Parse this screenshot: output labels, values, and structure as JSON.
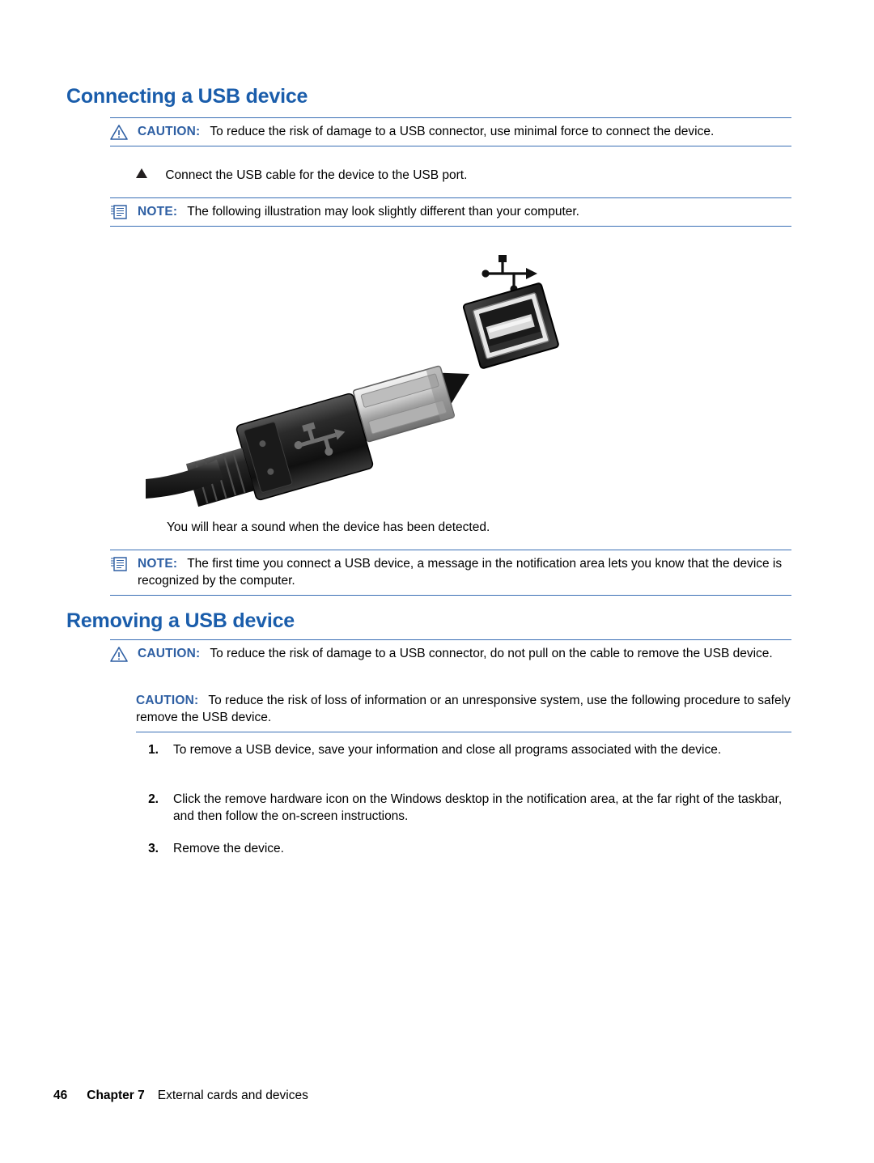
{
  "page": {
    "heading_connecting": "Connecting a USB device",
    "heading_removing": "Removing a USB device",
    "caution_label": "CAUTION:",
    "note_label": "NOTE:",
    "caution_connect_text": "To reduce the risk of damage to a USB connector, use minimal force to connect the device.",
    "bullet_connect": "Connect the USB cable for the device to the USB port.",
    "note_illustration": "The following illustration may look slightly different than your computer.",
    "sound_text": "You will hear a sound when the device has been detected.",
    "note_first_time": "The first time you connect a USB device, a message in the notification area lets you know that the device is recognized by the computer.",
    "caution_remove_1": "To reduce the risk of damage to a USB connector, do not pull on the cable to remove the USB device.",
    "caution_remove_2": "To reduce the risk of loss of information or an unresponsive system, use the following procedure to safely remove the USB device.",
    "steps": [
      {
        "num": "1.",
        "text": "To remove a USB device, save your information and close all programs associated with the device."
      },
      {
        "num": "2.",
        "text": "Click the remove hardware icon on the Windows desktop in the notification area, at the far right of the taskbar, and then follow the on-screen instructions."
      },
      {
        "num": "3.",
        "text": "Remove the device."
      }
    ],
    "footer": {
      "page_number": "46",
      "chapter": "Chapter 7",
      "chapter_title": "External cards and devices"
    },
    "illustration": {
      "name": "usb-cable-and-port-illustration",
      "usb_symbol": "usb-trident-symbol"
    },
    "colors": {
      "heading": "#1a5dab",
      "rule": "#3a6fb5",
      "label": "#2e5fa3"
    }
  }
}
